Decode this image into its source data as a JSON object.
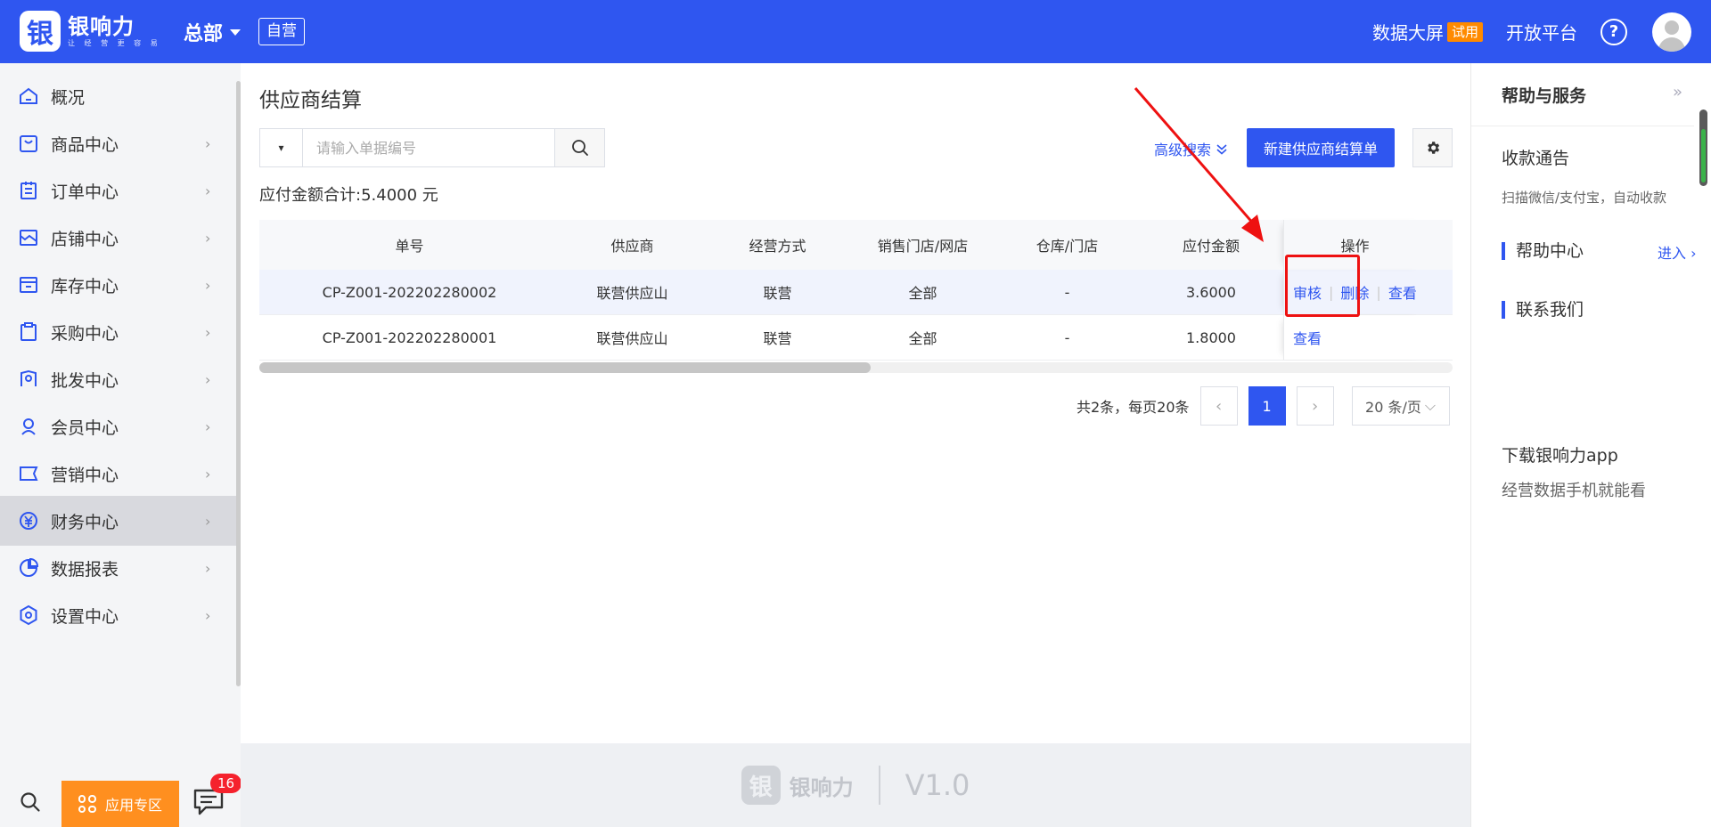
{
  "header": {
    "logo_mark": "银",
    "logo_name": "银响力",
    "logo_sub": "让 经 营 更 容 易",
    "org": "总部",
    "org_type": "自营",
    "bigscreen": "数据大屏",
    "trial": "试用",
    "open_platform": "开放平台",
    "help": "?"
  },
  "sidebar": {
    "items": [
      {
        "label": "概况",
        "icon": "home-icon"
      },
      {
        "label": "商品中心",
        "icon": "goods-icon"
      },
      {
        "label": "订单中心",
        "icon": "order-icon"
      },
      {
        "label": "店铺中心",
        "icon": "store-icon"
      },
      {
        "label": "库存中心",
        "icon": "inventory-icon"
      },
      {
        "label": "采购中心",
        "icon": "purchase-icon"
      },
      {
        "label": "批发中心",
        "icon": "wholesale-icon"
      },
      {
        "label": "会员中心",
        "icon": "member-icon"
      },
      {
        "label": "营销中心",
        "icon": "marketing-icon"
      },
      {
        "label": "财务中心",
        "icon": "finance-icon"
      },
      {
        "label": "数据报表",
        "icon": "report-icon"
      },
      {
        "label": "设置中心",
        "icon": "settings-icon"
      }
    ],
    "active_index": 9,
    "app_zone": "应用专区",
    "message_count": "16"
  },
  "main": {
    "title": "供应商结算",
    "search_placeholder": "请输入单据编号",
    "search_select": "▾",
    "advanced_search": "高级搜索",
    "new_button": "新建供应商结算单",
    "total": "应付金额合计:5.4000 元",
    "columns": [
      "单号",
      "供应商",
      "经营方式",
      "销售门店/网店",
      "仓库/门店",
      "应付金额",
      "操作"
    ],
    "rows": [
      {
        "no": "CP-Z001-202202280002",
        "supplier": "联营供应山",
        "mode": "联营",
        "store": "全部",
        "warehouse": "-",
        "amount": "3.6000",
        "ops": [
          "审核",
          "删除",
          "查看"
        ]
      },
      {
        "no": "CP-Z001-202202280001",
        "supplier": "联营供应山",
        "mode": "联营",
        "store": "全部",
        "warehouse": "-",
        "amount": "1.8000",
        "ops": [
          "查看"
        ]
      }
    ],
    "pagination": {
      "total_text": "共2条，每页20条",
      "current": "1",
      "page_size": "20 条/页"
    },
    "footer_name": "银响力",
    "footer_version": "V1.0"
  },
  "right_panel": {
    "title": "帮助与服务",
    "receipt_title": "收款通告",
    "receipt_desc": "扫描微信/支付宝，自动收款",
    "help_center": "帮助中心",
    "enter": "进入",
    "contact": "联系我们",
    "download_title": "下载银响力app",
    "download_desc": "经营数据手机就能看"
  },
  "colors": {
    "primary": "#2f56f0",
    "accent_orange": "#ff8f1f",
    "badge_red": "#f5222d",
    "annotation_red": "#e11111"
  }
}
